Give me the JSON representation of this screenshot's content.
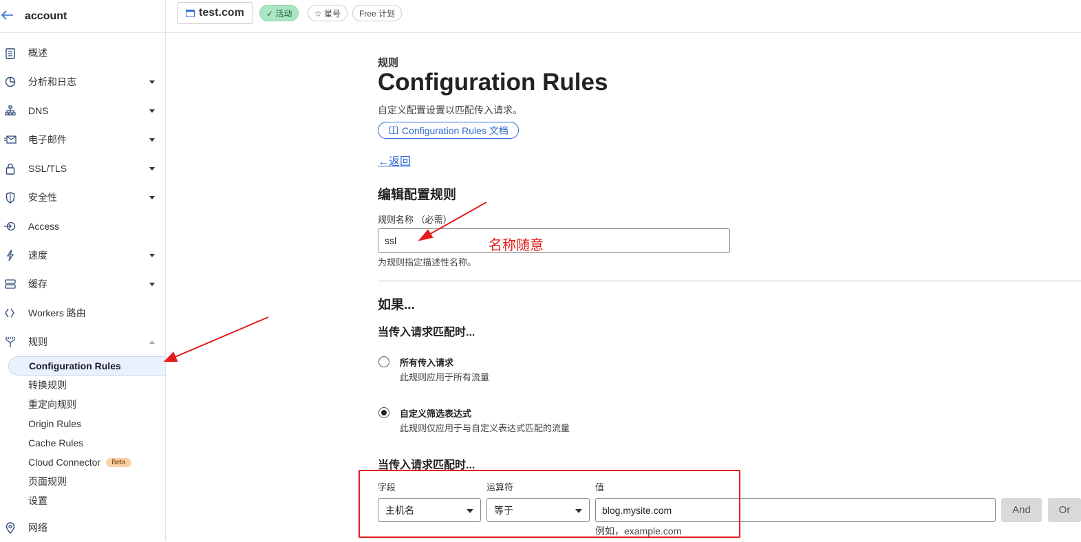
{
  "account": {
    "back_icon": "arrow-left-icon",
    "name": "account"
  },
  "topbar": {
    "domain": "test.com",
    "status": "✓ 活动",
    "star": "☆ 星号",
    "plan": "Free 计划"
  },
  "sidebar": {
    "items": [
      {
        "label": "概述",
        "icon": "clipboard-icon"
      },
      {
        "label": "分析和日志",
        "icon": "chart-pie-icon"
      },
      {
        "label": "DNS",
        "icon": "network-icon"
      },
      {
        "label": "电子邮件",
        "icon": "email-icon"
      },
      {
        "label": "SSL/TLS",
        "icon": "lock-icon"
      },
      {
        "label": "安全性",
        "icon": "shield-icon"
      },
      {
        "label": "Access",
        "icon": "access-icon"
      },
      {
        "label": "速度",
        "icon": "lightning-icon"
      },
      {
        "label": "缓存",
        "icon": "storage-icon"
      },
      {
        "label": "Workers 路由",
        "icon": "workers-icon"
      },
      {
        "label": "规则",
        "icon": "rules-icon"
      }
    ],
    "subitems": [
      "Configuration Rules",
      "转换规则",
      "重定向规则",
      "Origin Rules",
      "Cache Rules",
      "Cloud Connector",
      "页面规则",
      "设置"
    ],
    "beta_label": "Beta",
    "network": {
      "label": "网络",
      "icon": "location-pin-icon"
    }
  },
  "page": {
    "eyebrow": "规则",
    "title": "Configuration Rules",
    "description": "自定义配置设置以匹配传入请求。",
    "docs_button": "Configuration Rules 文档",
    "back_link": "←返回",
    "edit_heading": "编辑配置规则",
    "name_label": "规则名称 （必需）",
    "name_value": "ssl",
    "name_hint": "为规则指定描述性名称。",
    "if_heading": "如果...",
    "match_heading": "当传入请求匹配时...",
    "radio_all_title": "所有传入请求",
    "radio_all_desc": "此规则应用于所有流量",
    "radio_custom_title": "自定义筛选表达式",
    "radio_custom_desc": "此规则仅应用于与自定义表达式匹配的流量",
    "match_heading_2": "当传入请求匹配时...",
    "expr": {
      "field_label": "字段",
      "field_value": "主机名",
      "operator_label": "运算符",
      "operator_value": "等于",
      "value_label": "值",
      "value_value": "blog.mysite.com",
      "value_example": "例如，example.com",
      "and_button": "And",
      "or_button": "Or"
    }
  },
  "annotation": {
    "text": "名称随意",
    "color": "#e31e1e"
  },
  "colors": {
    "accent": "#2f6bd5",
    "active_badge": "#a9e6c1",
    "annotation_red": "#e31e1e"
  }
}
